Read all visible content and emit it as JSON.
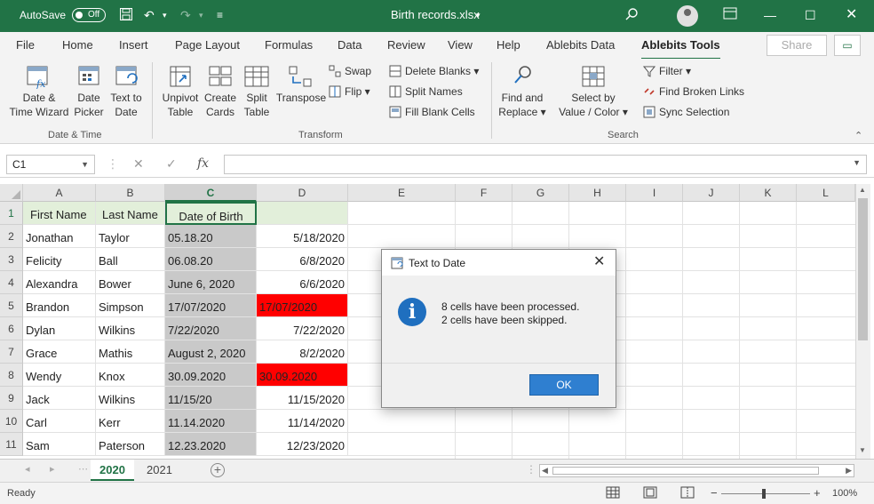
{
  "titlebar": {
    "autosave_label": "AutoSave",
    "autosave_state": "Off",
    "file_name": "Birth records.xlsx"
  },
  "tabs": [
    "File",
    "Home",
    "Insert",
    "Page Layout",
    "Formulas",
    "Data",
    "Review",
    "View",
    "Help",
    "Ablebits Data",
    "Ablebits Tools"
  ],
  "active_tab": "Ablebits Tools",
  "share_label": "Share",
  "ribbon": {
    "date_time": {
      "label": "Date & Time",
      "wizard": "Date &\nTime Wizard",
      "picker": "Date\nPicker",
      "text_to_date": "Text to\nDate"
    },
    "transform": {
      "label": "Transform",
      "unpivot": "Unpivot\nTable",
      "create_cards": "Create\nCards",
      "split_table": "Split\nTable",
      "transpose": "Transpose",
      "swap": "Swap",
      "flip": "Flip",
      "delete_blanks": "Delete Blanks",
      "split_names": "Split Names",
      "fill_blank_cells": "Fill Blank Cells"
    },
    "search": {
      "label": "Search",
      "find_replace": "Find and\nReplace",
      "select_by_value": "Select by\nValue / Color",
      "filter": "Filter",
      "find_broken_links": "Find Broken Links",
      "sync_selection": "Sync Selection"
    }
  },
  "formula_bar": {
    "name_box": "C1",
    "cancel": "✕",
    "enter": "✓",
    "fx": "fx",
    "value": ""
  },
  "columns": [
    "A",
    "B",
    "C",
    "D",
    "E",
    "F",
    "G",
    "H",
    "I",
    "J",
    "K",
    "L"
  ],
  "rows": [
    {
      "n": "1",
      "a": "First Name",
      "b": "Last Name",
      "c": "Date of Birth",
      "d": ""
    },
    {
      "n": "2",
      "a": "Jonathan",
      "b": "Taylor",
      "c": "05.18.20",
      "d": "5/18/2020"
    },
    {
      "n": "3",
      "a": "Felicity",
      "b": "Ball",
      "c": "06.08.20",
      "d": "6/8/2020"
    },
    {
      "n": "4",
      "a": "Alexandra",
      "b": "Bower",
      "c": "June 6, 2020",
      "d": "6/6/2020"
    },
    {
      "n": "5",
      "a": "Brandon",
      "b": "Simpson",
      "c": "17/07/2020",
      "d": "17/07/2020"
    },
    {
      "n": "6",
      "a": "Dylan",
      "b": "Wilkins",
      "c": "7/22/2020",
      "d": "7/22/2020"
    },
    {
      "n": "7",
      "a": "Grace",
      "b": "Mathis",
      "c": "August 2, 2020",
      "d": "8/2/2020"
    },
    {
      "n": "8",
      "a": "Wendy",
      "b": "Knox",
      "c": "30.09.2020",
      "d": "30.09.2020"
    },
    {
      "n": "9",
      "a": "Jack",
      "b": "Wilkins",
      "c": "11/15/20",
      "d": "11/15/2020"
    },
    {
      "n": "10",
      "a": "Carl",
      "b": "Kerr",
      "c": "11.14.2020",
      "d": "11/14/2020"
    },
    {
      "n": "11",
      "a": "Sam",
      "b": "Paterson",
      "c": "12.23.2020",
      "d": "12/23/2020"
    }
  ],
  "sheet_tabs": [
    "2020",
    "2021"
  ],
  "active_sheet": "2020",
  "status": {
    "ready": "Ready",
    "zoom": "100%"
  },
  "dialog": {
    "title": "Text to Date",
    "line1": "8 cells have been processed.",
    "line2": "2 cells have been skipped.",
    "ok": "OK"
  },
  "colors": {
    "excel_green": "#217346",
    "header_fill": "#e2efda",
    "selected_fill": "#c9c9c9",
    "error_fill": "#ff0000",
    "ok_blue": "#2f7fd0"
  }
}
